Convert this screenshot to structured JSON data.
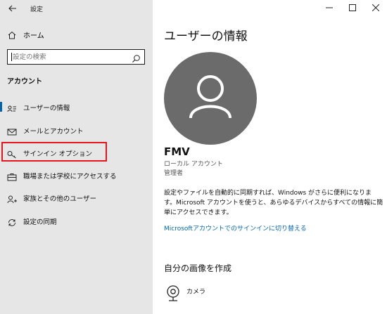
{
  "window": {
    "title": "設定"
  },
  "sidebar": {
    "home_label": "ホーム",
    "search_placeholder": "設定の検索",
    "section_heading": "アカウント",
    "items": [
      {
        "label": "ユーザーの情報",
        "icon": "user-card-icon",
        "selected": true
      },
      {
        "label": "メールとアカウント",
        "icon": "mail-icon",
        "selected": false
      },
      {
        "label": "サインイン オプション",
        "icon": "key-icon",
        "selected": false,
        "highlighted": true
      },
      {
        "label": "職場または学校にアクセスする",
        "icon": "briefcase-icon",
        "selected": false
      },
      {
        "label": "家族とその他のユーザー",
        "icon": "add-person-icon",
        "selected": false
      },
      {
        "label": "設定の同期",
        "icon": "sync-icon",
        "selected": false
      }
    ]
  },
  "main": {
    "page_title": "ユーザーの情報",
    "user_name": "FMV",
    "account_type": "ローカル アカウント",
    "account_role": "管理者",
    "sync_description": "設定やファイルを自動的に同期すれば、Windows がさらに便利になります。Microsoft アカウントを使うと、あらゆるデバイスからすべての情報に簡単にアクセスできます。",
    "ms_account_link": "Microsoftアカウントでのサインインに切り替える",
    "create_picture_heading": "自分の画像を作成",
    "camera_label": "カメラ"
  },
  "colors": {
    "sidebar_bg": "#e6e6e6",
    "accent": "#0063b1",
    "link": "#0066b4",
    "highlight_border": "#e8141b",
    "avatar_bg": "#6b6b6b"
  }
}
